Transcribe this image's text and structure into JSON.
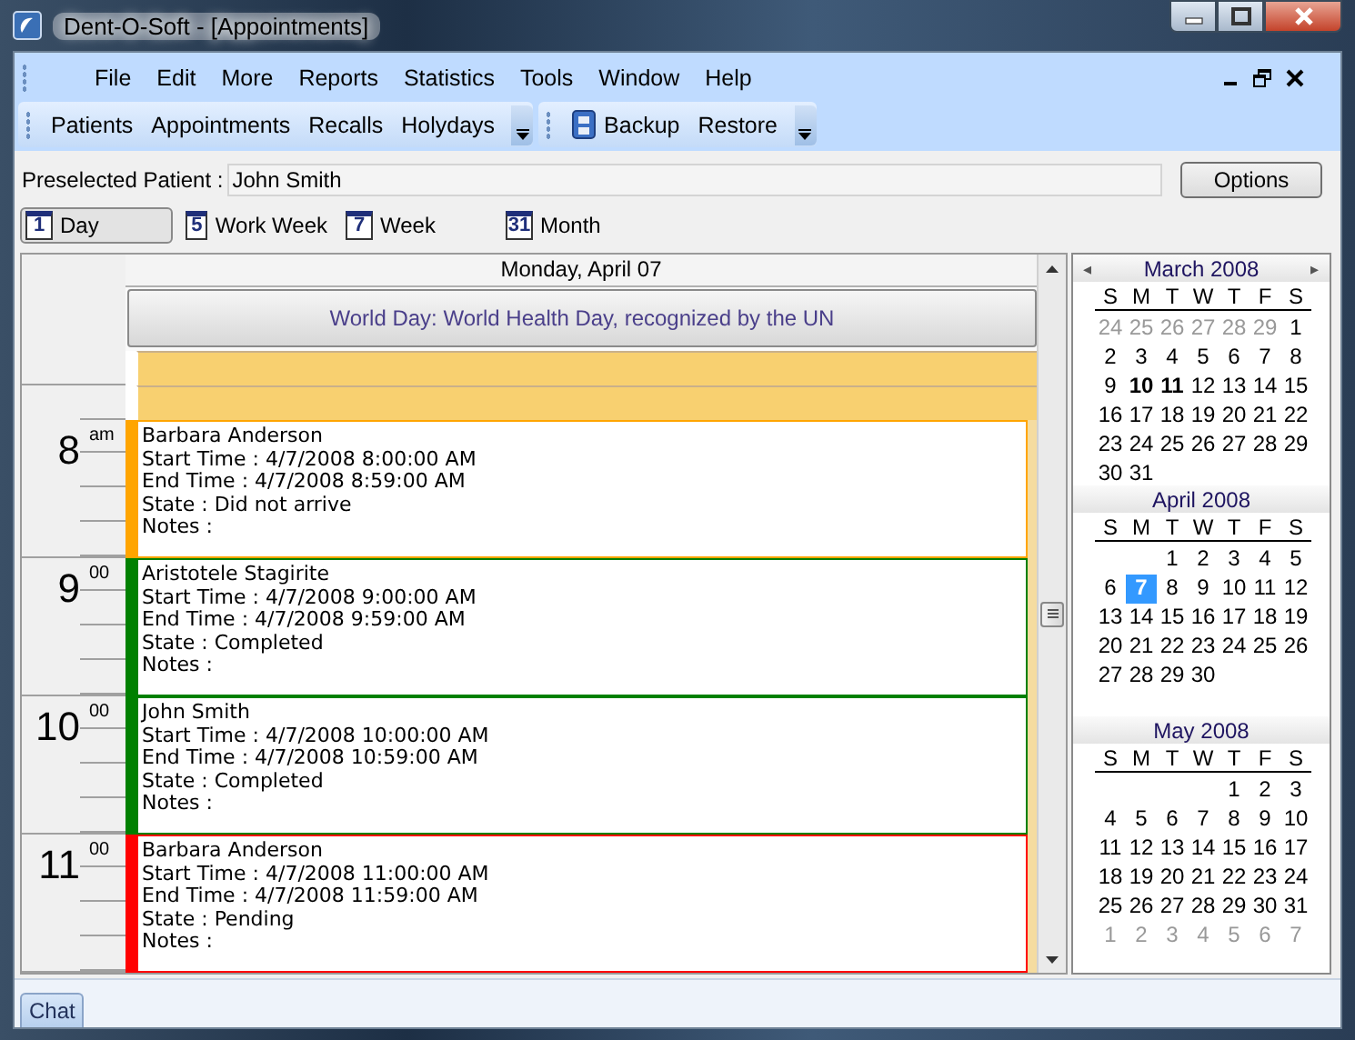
{
  "window": {
    "title": "Dent-O-Soft - [Appointments]"
  },
  "menu": [
    "File",
    "Edit",
    "More",
    "Reports",
    "Statistics",
    "Tools",
    "Window",
    "Help"
  ],
  "toolbars": [
    {
      "items": [
        {
          "label": "Patients",
          "kind": "text"
        },
        {
          "label": "Appointments",
          "kind": "text"
        },
        {
          "label": "Recalls",
          "kind": "text"
        },
        {
          "label": "Holydays",
          "kind": "text"
        }
      ]
    },
    {
      "items": [
        {
          "label": "Backup",
          "kind": "with_icon"
        },
        {
          "label": "Restore",
          "kind": "text"
        }
      ]
    }
  ],
  "preselected": {
    "label": "Preselected Patient :",
    "value": "John Smith",
    "button": "Options"
  },
  "views": [
    {
      "icon_text": "1",
      "label": "Day",
      "selected": true
    },
    {
      "icon_text": "5",
      "label": "Work Week",
      "selected": false
    },
    {
      "icon_text": "7",
      "label": "Week",
      "selected": false
    },
    {
      "icon_text": "31",
      "label": "Month",
      "selected": false
    }
  ],
  "day_view": {
    "header": "Monday, April 07",
    "holiday": "World Day: World Health Day, recognized by the UN",
    "hours": [
      {
        "hour": "8",
        "suffix": "am"
      },
      {
        "hour": "9",
        "suffix": "00"
      },
      {
        "hour": "10",
        "suffix": "00"
      },
      {
        "hour": "11",
        "suffix": "00"
      }
    ],
    "appointments": [
      {
        "patient": "Barbara Anderson",
        "lines": [
          "Start Time : 4/7/2008 8:00:00 AM",
          "End Time : 4/7/2008 8:59:00 AM",
          "State : Did not arrive",
          "Notes :"
        ],
        "color": "#ffa500"
      },
      {
        "patient": "Aristotele Stagirite",
        "lines": [
          "Start Time : 4/7/2008 9:00:00 AM",
          "End Time : 4/7/2008 9:59:00 AM",
          "State : Completed",
          "Notes :"
        ],
        "color": "#008000"
      },
      {
        "patient": "John Smith",
        "lines": [
          "Start Time : 4/7/2008 10:00:00 AM",
          "End Time : 4/7/2008 10:59:00 AM",
          "State : Completed",
          "Notes :"
        ],
        "color": "#008000"
      },
      {
        "patient": "Barbara Anderson",
        "lines": [
          "Start Time : 4/7/2008 11:00:00 AM",
          "End Time : 4/7/2008 11:59:00 AM",
          "State : Pending",
          "Notes :"
        ],
        "color": "#ff0000"
      }
    ]
  },
  "mini_calendar": {
    "prev": "◂",
    "next": "▸",
    "months": [
      {
        "title": "March 2008",
        "weekdays": [
          "S",
          "M",
          "T",
          "W",
          "T",
          "F",
          "S"
        ],
        "weeks": [
          [
            {
              "day": "24",
              "other_month": true,
              "bold": false,
              "selected": false
            },
            {
              "day": "25",
              "other_month": true,
              "bold": false,
              "selected": false
            },
            {
              "day": "26",
              "other_month": true,
              "bold": false,
              "selected": false
            },
            {
              "day": "27",
              "other_month": true,
              "bold": false,
              "selected": false
            },
            {
              "day": "28",
              "other_month": true,
              "bold": false,
              "selected": false
            },
            {
              "day": "29",
              "other_month": true,
              "bold": false,
              "selected": false
            },
            {
              "day": "1",
              "other_month": false,
              "bold": false,
              "selected": false
            }
          ],
          [
            {
              "day": "2",
              "other_month": false,
              "bold": false,
              "selected": false
            },
            {
              "day": "3",
              "other_month": false,
              "bold": false,
              "selected": false
            },
            {
              "day": "4",
              "other_month": false,
              "bold": false,
              "selected": false
            },
            {
              "day": "5",
              "other_month": false,
              "bold": false,
              "selected": false
            },
            {
              "day": "6",
              "other_month": false,
              "bold": false,
              "selected": false
            },
            {
              "day": "7",
              "other_month": false,
              "bold": false,
              "selected": false
            },
            {
              "day": "8",
              "other_month": false,
              "bold": false,
              "selected": false
            }
          ],
          [
            {
              "day": "9",
              "other_month": false,
              "bold": false,
              "selected": false
            },
            {
              "day": "10",
              "other_month": false,
              "bold": true,
              "selected": false
            },
            {
              "day": "11",
              "other_month": false,
              "bold": true,
              "selected": false
            },
            {
              "day": "12",
              "other_month": false,
              "bold": false,
              "selected": false
            },
            {
              "day": "13",
              "other_month": false,
              "bold": false,
              "selected": false
            },
            {
              "day": "14",
              "other_month": false,
              "bold": false,
              "selected": false
            },
            {
              "day": "15",
              "other_month": false,
              "bold": false,
              "selected": false
            }
          ],
          [
            {
              "day": "16",
              "other_month": false,
              "bold": false,
              "selected": false
            },
            {
              "day": "17",
              "other_month": false,
              "bold": false,
              "selected": false
            },
            {
              "day": "18",
              "other_month": false,
              "bold": false,
              "selected": false
            },
            {
              "day": "19",
              "other_month": false,
              "bold": false,
              "selected": false
            },
            {
              "day": "20",
              "other_month": false,
              "bold": false,
              "selected": false
            },
            {
              "day": "21",
              "other_month": false,
              "bold": false,
              "selected": false
            },
            {
              "day": "22",
              "other_month": false,
              "bold": false,
              "selected": false
            }
          ],
          [
            {
              "day": "23",
              "other_month": false,
              "bold": false,
              "selected": false
            },
            {
              "day": "24",
              "other_month": false,
              "bold": false,
              "selected": false
            },
            {
              "day": "25",
              "other_month": false,
              "bold": false,
              "selected": false
            },
            {
              "day": "26",
              "other_month": false,
              "bold": false,
              "selected": false
            },
            {
              "day": "27",
              "other_month": false,
              "bold": false,
              "selected": false
            },
            {
              "day": "28",
              "other_month": false,
              "bold": false,
              "selected": false
            },
            {
              "day": "29",
              "other_month": false,
              "bold": false,
              "selected": false
            }
          ],
          [
            {
              "day": "30",
              "other_month": false,
              "bold": false,
              "selected": false
            },
            {
              "day": "31",
              "other_month": false,
              "bold": false,
              "selected": false
            }
          ]
        ]
      },
      {
        "title": "April 2008",
        "weekdays": [
          "S",
          "M",
          "T",
          "W",
          "T",
          "F",
          "S"
        ],
        "weeks": [
          [
            {
              "day": "1",
              "other_month": false,
              "bold": false,
              "selected": false
            },
            {
              "day": "2",
              "other_month": false,
              "bold": false,
              "selected": false
            },
            {
              "day": "3",
              "other_month": false,
              "bold": false,
              "selected": false
            },
            {
              "day": "4",
              "other_month": false,
              "bold": false,
              "selected": false
            },
            {
              "day": "5",
              "other_month": false,
              "bold": false,
              "selected": false
            }
          ],
          [
            {
              "day": "6",
              "other_month": false,
              "bold": false,
              "selected": false
            },
            {
              "day": "7",
              "other_month": false,
              "bold": true,
              "selected": true
            },
            {
              "day": "8",
              "other_month": false,
              "bold": false,
              "selected": false
            },
            {
              "day": "9",
              "other_month": false,
              "bold": false,
              "selected": false
            },
            {
              "day": "10",
              "other_month": false,
              "bold": false,
              "selected": false
            },
            {
              "day": "11",
              "other_month": false,
              "bold": false,
              "selected": false
            },
            {
              "day": "12",
              "other_month": false,
              "bold": false,
              "selected": false
            }
          ],
          [
            {
              "day": "13",
              "other_month": false,
              "bold": false,
              "selected": false
            },
            {
              "day": "14",
              "other_month": false,
              "bold": false,
              "selected": false
            },
            {
              "day": "15",
              "other_month": false,
              "bold": false,
              "selected": false
            },
            {
              "day": "16",
              "other_month": false,
              "bold": false,
              "selected": false
            },
            {
              "day": "17",
              "other_month": false,
              "bold": false,
              "selected": false
            },
            {
              "day": "18",
              "other_month": false,
              "bold": false,
              "selected": false
            },
            {
              "day": "19",
              "other_month": false,
              "bold": false,
              "selected": false
            }
          ],
          [
            {
              "day": "20",
              "other_month": false,
              "bold": false,
              "selected": false
            },
            {
              "day": "21",
              "other_month": false,
              "bold": false,
              "selected": false
            },
            {
              "day": "22",
              "other_month": false,
              "bold": false,
              "selected": false
            },
            {
              "day": "23",
              "other_month": false,
              "bold": false,
              "selected": false
            },
            {
              "day": "24",
              "other_month": false,
              "bold": false,
              "selected": false
            },
            {
              "day": "25",
              "other_month": false,
              "bold": false,
              "selected": false
            },
            {
              "day": "26",
              "other_month": false,
              "bold": false,
              "selected": false
            }
          ],
          [
            {
              "day": "27",
              "other_month": false,
              "bold": false,
              "selected": false
            },
            {
              "day": "28",
              "other_month": false,
              "bold": false,
              "selected": false
            },
            {
              "day": "29",
              "other_month": false,
              "bold": false,
              "selected": false
            },
            {
              "day": "30",
              "other_month": false,
              "bold": false,
              "selected": false
            }
          ]
        ]
      },
      {
        "title": "May 2008",
        "weekdays": [
          "S",
          "M",
          "T",
          "W",
          "T",
          "F",
          "S"
        ],
        "weeks": [
          [
            {
              "day": "1",
              "other_month": false,
              "bold": false,
              "selected": false
            },
            {
              "day": "2",
              "other_month": false,
              "bold": false,
              "selected": false
            },
            {
              "day": "3",
              "other_month": false,
              "bold": false,
              "selected": false
            }
          ],
          [
            {
              "day": "4",
              "other_month": false,
              "bold": false,
              "selected": false
            },
            {
              "day": "5",
              "other_month": false,
              "bold": false,
              "selected": false
            },
            {
              "day": "6",
              "other_month": false,
              "bold": false,
              "selected": false
            },
            {
              "day": "7",
              "other_month": false,
              "bold": false,
              "selected": false
            },
            {
              "day": "8",
              "other_month": false,
              "bold": false,
              "selected": false
            },
            {
              "day": "9",
              "other_month": false,
              "bold": false,
              "selected": false
            },
            {
              "day": "10",
              "other_month": false,
              "bold": false,
              "selected": false
            }
          ],
          [
            {
              "day": "11",
              "other_month": false,
              "bold": false,
              "selected": false
            },
            {
              "day": "12",
              "other_month": false,
              "bold": false,
              "selected": false
            },
            {
              "day": "13",
              "other_month": false,
              "bold": false,
              "selected": false
            },
            {
              "day": "14",
              "other_month": false,
              "bold": false,
              "selected": false
            },
            {
              "day": "15",
              "other_month": false,
              "bold": false,
              "selected": false
            },
            {
              "day": "16",
              "other_month": false,
              "bold": false,
              "selected": false
            },
            {
              "day": "17",
              "other_month": false,
              "bold": false,
              "selected": false
            }
          ],
          [
            {
              "day": "18",
              "other_month": false,
              "bold": false,
              "selected": false
            },
            {
              "day": "19",
              "other_month": false,
              "bold": false,
              "selected": false
            },
            {
              "day": "20",
              "other_month": false,
              "bold": false,
              "selected": false
            },
            {
              "day": "21",
              "other_month": false,
              "bold": false,
              "selected": false
            },
            {
              "day": "22",
              "other_month": false,
              "bold": false,
              "selected": false
            },
            {
              "day": "23",
              "other_month": false,
              "bold": false,
              "selected": false
            },
            {
              "day": "24",
              "other_month": false,
              "bold": false,
              "selected": false
            }
          ],
          [
            {
              "day": "25",
              "other_month": false,
              "bold": false,
              "selected": false
            },
            {
              "day": "26",
              "other_month": false,
              "bold": false,
              "selected": false
            },
            {
              "day": "27",
              "other_month": false,
              "bold": false,
              "selected": false
            },
            {
              "day": "28",
              "other_month": false,
              "bold": false,
              "selected": false
            },
            {
              "day": "29",
              "other_month": false,
              "bold": false,
              "selected": false
            },
            {
              "day": "30",
              "other_month": false,
              "bold": false,
              "selected": false
            },
            {
              "day": "31",
              "other_month": false,
              "bold": false,
              "selected": false
            }
          ],
          [
            {
              "day": "1",
              "other_month": true,
              "bold": false,
              "selected": false
            },
            {
              "day": "2",
              "other_month": true,
              "bold": false,
              "selected": false
            },
            {
              "day": "3",
              "other_month": true,
              "bold": false,
              "selected": false
            },
            {
              "day": "4",
              "other_month": true,
              "bold": false,
              "selected": false
            },
            {
              "day": "5",
              "other_month": true,
              "bold": false,
              "selected": false
            },
            {
              "day": "6",
              "other_month": true,
              "bold": false,
              "selected": false
            },
            {
              "day": "7",
              "other_month": true,
              "bold": false,
              "selected": false
            }
          ]
        ]
      }
    ]
  },
  "bottom_tabs": [
    "Chat"
  ]
}
